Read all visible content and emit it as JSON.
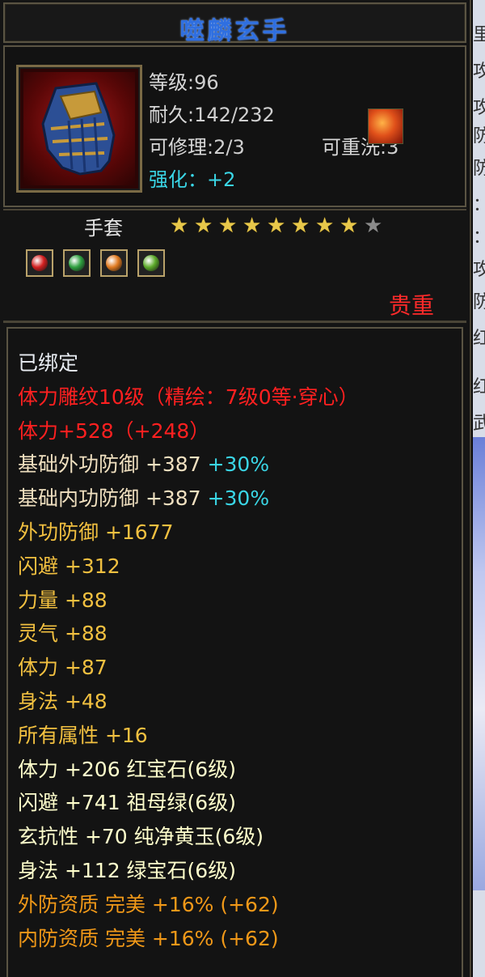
{
  "item": {
    "name": "噬麟玄手",
    "level_label": "等级",
    "level": "96",
    "durability_label": "耐久",
    "durability": "142/232",
    "repair_label": "可修理",
    "repair": "2/3",
    "rewash_label": "可重洗",
    "rewash": "3",
    "enhance_label": "强化：",
    "enhance": "+2",
    "type": "手套",
    "stars_filled": 8,
    "stars_total": 9,
    "rarity": "贵重",
    "gems": [
      {
        "icon": "red-gem-icon",
        "color": "#d42020"
      },
      {
        "icon": "green-gem-icon",
        "color": "#2fa040"
      },
      {
        "icon": "yellow-gem-icon",
        "color": "#e07a20"
      },
      {
        "icon": "jade-gem-icon",
        "color": "#5caa2a"
      }
    ]
  },
  "attributes": {
    "bound": "已绑定",
    "engrave": "体力雕纹10级（精绘：7级0等·穿心）",
    "stamina_bonus": "体力+528（+248）",
    "base_ext_def": "基础外功防御 +387",
    "base_ext_def_pct": "+30%",
    "base_int_def": "基础内功防御 +387",
    "base_int_def_pct": "+30%",
    "ext_def": "外功防御 +1677",
    "dodge": "闪避 +312",
    "strength": "力量 +88",
    "spirit": "灵气 +88",
    "stamina": "体力 +87",
    "agility": "身法 +48",
    "all_attr": "所有属性 +16",
    "gem1": "体力 +206 红宝石(6级)",
    "gem2": "闪避 +741 祖母绿(6级)",
    "gem3": "玄抗性 +70 纯净黄玉(6级)",
    "gem4": "身法 +112 绿宝石(6级)",
    "q1": "外防资质  完美 +16% (+62)",
    "q2": "内防资质  完美 +16% (+62)"
  },
  "side_chars": [
    "里",
    "攻",
    "攻",
    "防",
    "防",
    "：",
    "：",
    "攻",
    "防",
    "红",
    "红",
    "武"
  ]
}
